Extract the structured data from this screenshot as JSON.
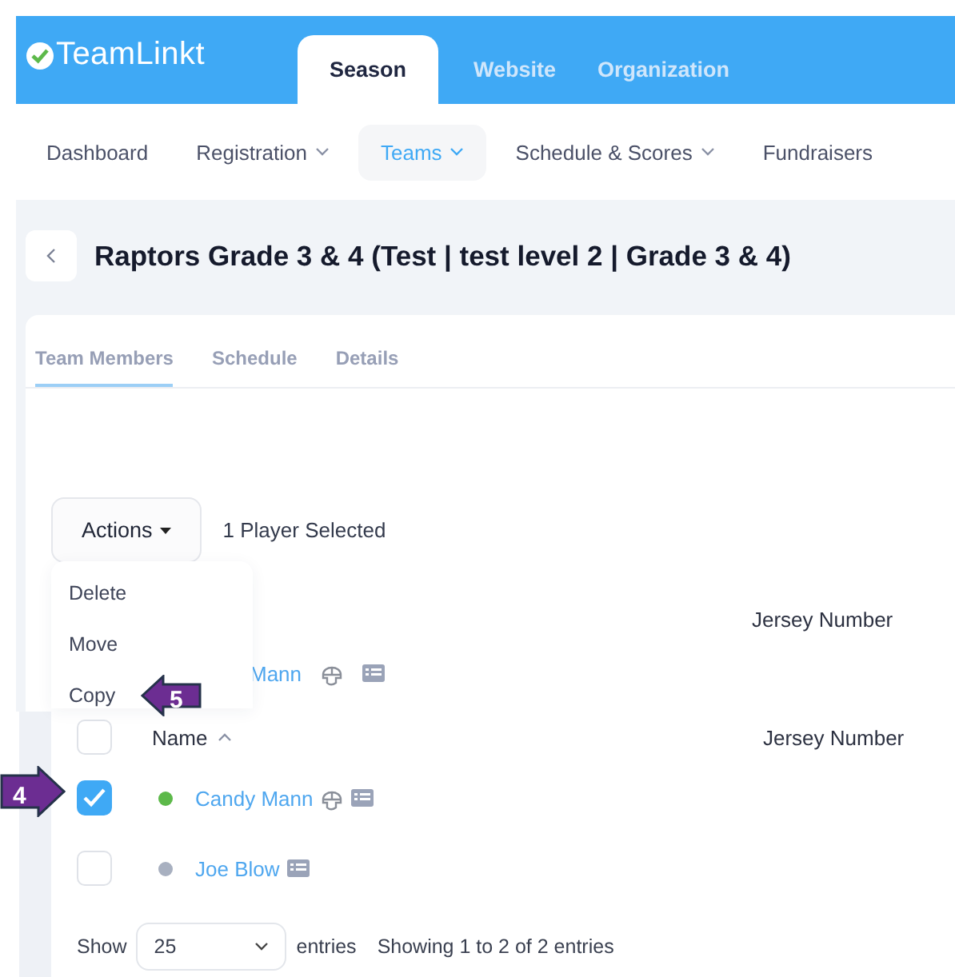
{
  "app": {
    "logo": "TeamLinkt",
    "tabs": [
      {
        "label": "Season",
        "selected": true
      },
      {
        "label": "Website",
        "selected": false
      },
      {
        "label": "Organization",
        "selected": false
      }
    ]
  },
  "nav": [
    {
      "label": "Dashboard",
      "dropdown": false,
      "selected": false
    },
    {
      "label": "Registration",
      "dropdown": true,
      "selected": false
    },
    {
      "label": "Teams",
      "dropdown": true,
      "selected": true
    },
    {
      "label": "Schedule & Scores",
      "dropdown": true,
      "selected": false
    },
    {
      "label": "Fundraisers",
      "dropdown": false,
      "selected": false
    }
  ],
  "page": {
    "title": "Raptors Grade 3 & 4 (Test | test level 2 | Grade 3 & 4)",
    "tabs": [
      {
        "label": "Team Members",
        "selected": true
      },
      {
        "label": "Schedule",
        "selected": false
      },
      {
        "label": "Details",
        "selected": false
      }
    ]
  },
  "actions": {
    "button": "Actions",
    "selection": "1 Player Selected",
    "menu": [
      {
        "label": "Delete"
      },
      {
        "label": "Move"
      },
      {
        "label": "Copy",
        "callout": "5"
      }
    ]
  },
  "background_table": {
    "column": "Jersey Number",
    "row": {
      "name": "Mann",
      "helmet": true
    }
  },
  "table": {
    "select_all": {
      "checked": false
    },
    "columns": [
      {
        "label": "Name",
        "sorted": true
      },
      {
        "label": "Jersey Number",
        "sorted": false
      }
    ],
    "rows": [
      {
        "name": "Candy Mann",
        "checked": true,
        "color": "#5db94a",
        "helmet": true,
        "callout": "4"
      },
      {
        "name": "Joe Blow",
        "checked": false,
        "color": "#a8b0c0",
        "helmet": false
      }
    ]
  },
  "footer": {
    "show": "Show",
    "page_size": "25",
    "entries": "entries",
    "info": "Showing 1 to 2 of 2 entries"
  }
}
